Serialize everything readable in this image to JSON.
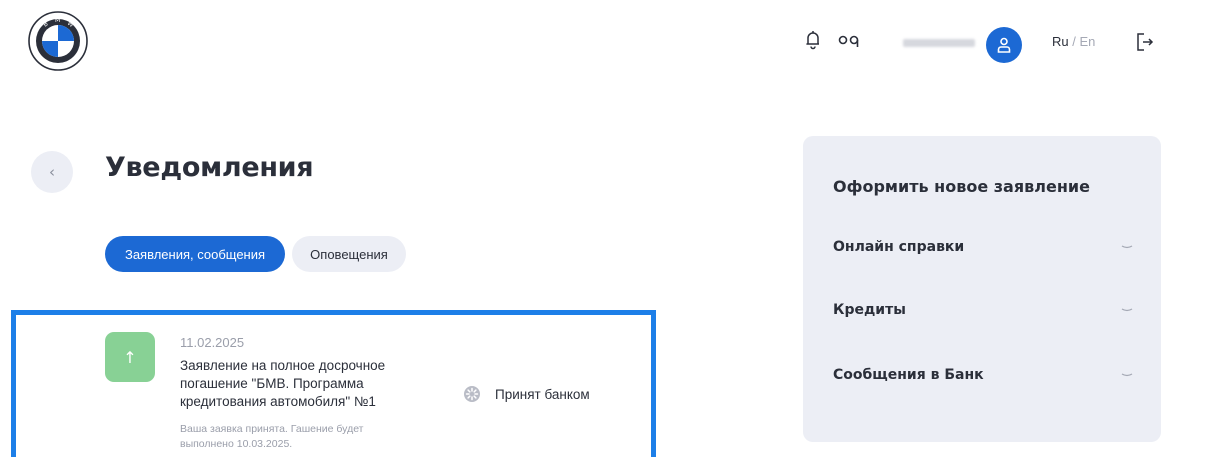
{
  "header": {
    "logo_text": "BMW",
    "icons": [
      "bell-icon",
      "glasses-icon",
      "user-icon",
      "logout-icon"
    ],
    "lang_ru": "Ru",
    "lang_separator": " / ",
    "lang_en": "En"
  },
  "page": {
    "title": "Уведомления"
  },
  "tabs": [
    {
      "label": "Заявления, сообщения",
      "active": true
    },
    {
      "label": "Оповещения",
      "active": false
    }
  ],
  "notifications": [
    {
      "date": "11.02.2025",
      "title": "Заявление на полное досрочное погашение \"БМВ. Программа кредитования автомобиля\" №1",
      "note": "Ваша заявка принята. Гашение будет выполнено 10.03.2025.",
      "status": "Принят банком",
      "icon": "arrow-up-icon"
    }
  ],
  "side_panel": {
    "title": "Оформить новое заявление",
    "items": [
      {
        "label": "Онлайн справки"
      },
      {
        "label": "Кредиты"
      },
      {
        "label": "Сообщения в Банк"
      }
    ]
  },
  "colors": {
    "brand_blue": "#1c69d4",
    "highlight_border": "#1d7fe8",
    "panel_bg": "#eceef5",
    "status_green": "#88d195"
  }
}
